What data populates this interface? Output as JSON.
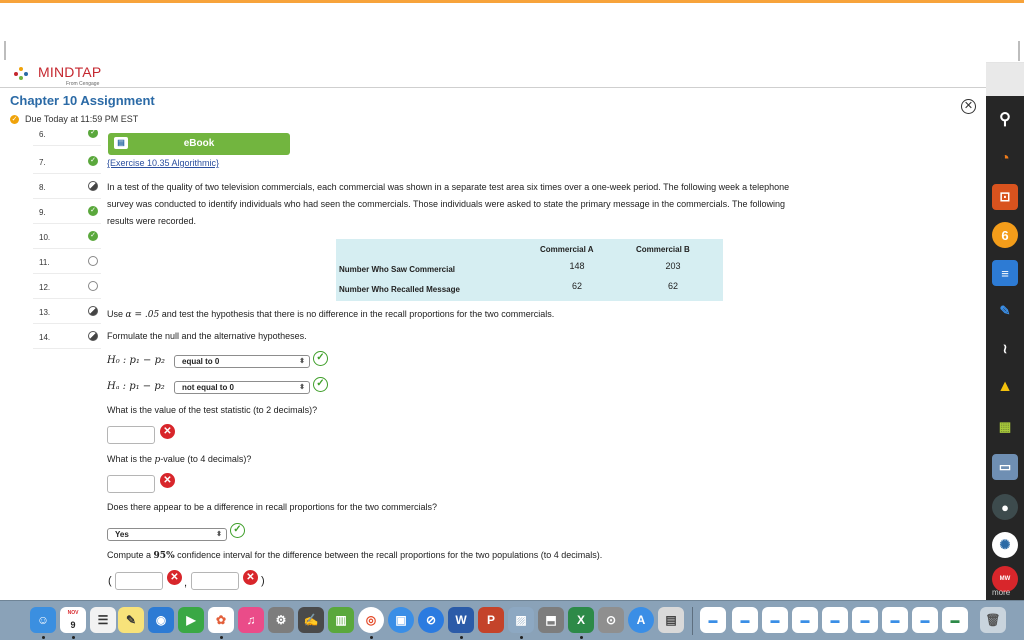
{
  "app": {
    "logo_text": "MINDTAP",
    "logo_sub": "From Cengage",
    "assignment_title": "Chapter 10 Assignment",
    "due_text": "Due Today at 11:59 PM EST",
    "close_symbol": "✕"
  },
  "question_nav": [
    {
      "num": "6.",
      "status": "ok"
    },
    {
      "num": "7.",
      "status": "ok"
    },
    {
      "num": "8.",
      "status": "partial"
    },
    {
      "num": "9.",
      "status": "ok"
    },
    {
      "num": "10.",
      "status": "ok"
    },
    {
      "num": "11.",
      "status": "empty"
    },
    {
      "num": "12.",
      "status": "empty"
    },
    {
      "num": "13.",
      "status": "partial"
    },
    {
      "num": "14.",
      "status": "partial"
    }
  ],
  "ebook": {
    "label": "eBook"
  },
  "question": {
    "exercise_link": "{Exercise 10.35 Algorithmic}",
    "intro_line1": "In a test of the quality of two television commercials, each commercial was shown in a separate test area six times over a one-week period. The following week a telephone",
    "intro_line2": "survey was conducted to identify individuals who had seen the commercials. Those individuals were asked to state the primary message in the commercials. The following",
    "intro_line3": "results were recorded.",
    "table": {
      "col_headers": [
        "Commercial A",
        "Commercial B"
      ],
      "rows": [
        {
          "label": "Number Who Saw Commercial",
          "values": [
            "148",
            "203"
          ]
        },
        {
          "label": "Number Who Recalled Message",
          "values": [
            "62",
            "62"
          ]
        }
      ]
    },
    "instruction_prefix": "Use",
    "instruction_alpha": "α = .05",
    "instruction_suffix": "and test the hypothesis that there is no difference in the recall proportions for the two commercials.",
    "formulate": "Formulate the null and the alternative hypotheses.",
    "h0_label": "H₀ : p₁ − p₂",
    "h0_value": "equal to 0",
    "ha_label": "Hₐ : p₁ − p₂",
    "ha_value": "not equal to 0",
    "q_test_stat": "What is the value of the test statistic (to 2 decimals)?",
    "q_pvalue_prefix": "What is the",
    "q_pvalue_var": "p",
    "q_pvalue_suffix": "-value (to 4 decimals)?",
    "q_difference": "Does there appear to be a difference in recall proportions for the two commercials?",
    "difference_value": "Yes",
    "q_ci_prefix": "Compute a",
    "q_ci_pct": "95%",
    "q_ci_suffix": "confidence interval for the difference between the recall proportions for the two populations (to 4 decimals).",
    "paren_open": "(",
    "comma": ",",
    "paren_close": ")"
  },
  "sidebar": {
    "more_label": "more"
  },
  "dock": {
    "calendar_month": "NOV",
    "calendar_day": "9"
  }
}
